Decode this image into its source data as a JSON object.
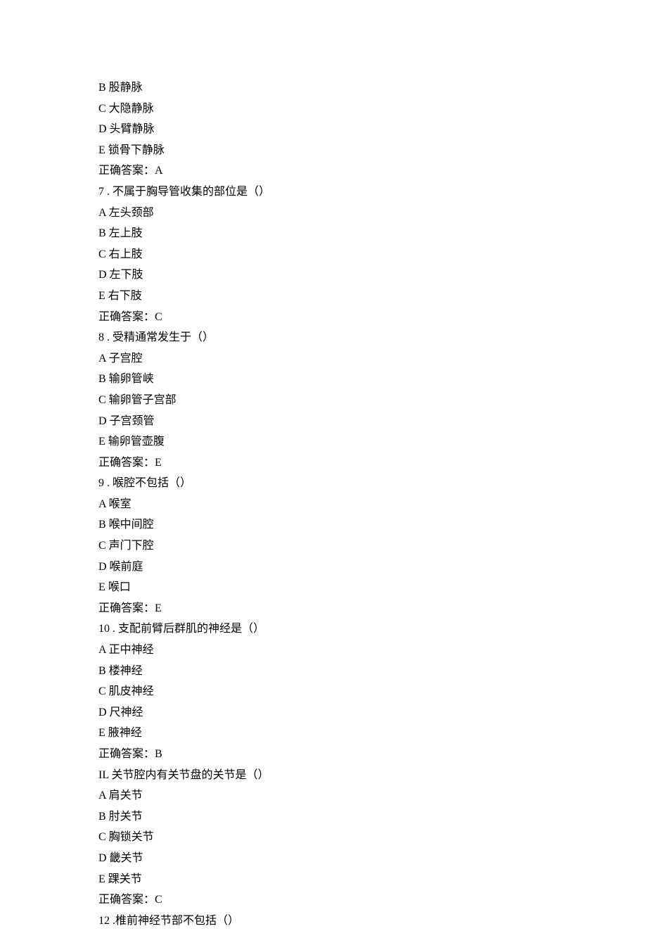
{
  "lines": [
    "B 股静脉",
    "C 大隐静脉",
    "D 头臂静脉",
    "E 锁骨下静脉",
    "正确答案：A",
    "7   . 不属于胸导管收集的部位是（）",
    "A 左头颈部",
    "B 左上肢",
    "C 右上肢",
    "D 左下肢",
    "E 右下肢",
    "正确答案：C",
    "8   . 受精通常发生于（）",
    "A 子宫腔",
    "B 输卵管峡",
    "C 输卵管子宫部",
    "D 子宫颈管",
    "E 输卵管壶腹",
    "正确答案：E",
    "9   . 喉腔不包括（）",
    "A 喉室",
    "B 喉中间腔",
    "C 声门下腔",
    "D 喉前庭",
    "E 喉口",
    "正确答案：E",
    "10   . 支配前臂后群肌的神经是（）",
    "A 正中神经",
    "B 楼神经",
    "C 肌皮神经",
    "D 尺神经",
    "E 腋神经",
    "正确答案：B",
    "IL 关节腔内有关节盘的关节是（）",
    "A 肩关节",
    "B 肘关节",
    "C 胸锁关节",
    "D 畿关节",
    "E 踝关节",
    "正确答案：C",
    "12   .椎前神经节部不包括（）"
  ]
}
